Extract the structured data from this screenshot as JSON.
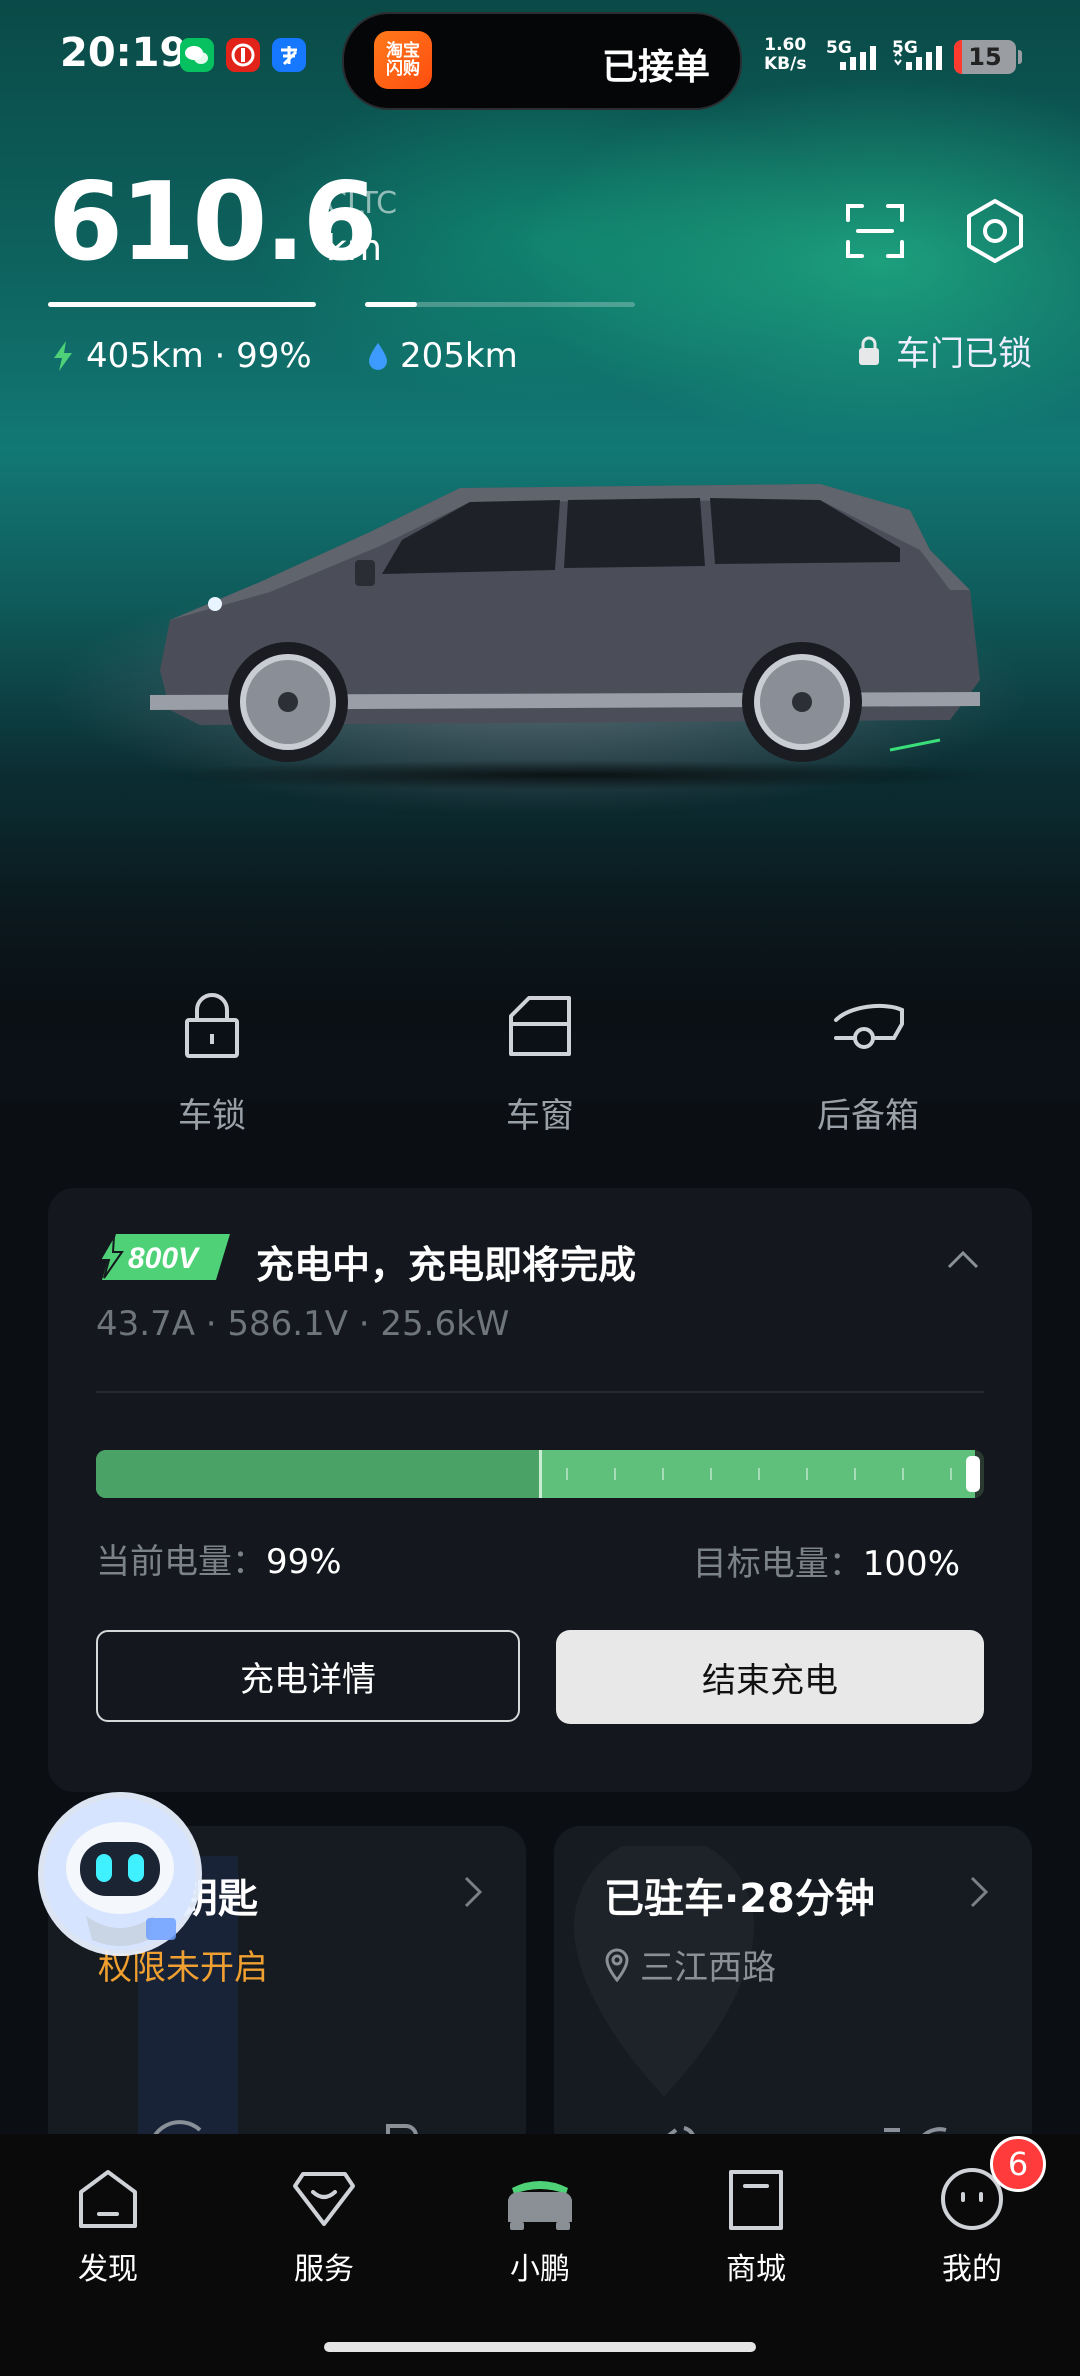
{
  "status_bar": {
    "time": "20:19",
    "island_app_label": "淘宝\n闪购",
    "island_text": "已接单",
    "net_speed_value": "1.60",
    "net_speed_unit": "KB/s",
    "sig1_label": "5G",
    "sig2_label": "5G",
    "battery": "15",
    "app_icons": [
      "wechat-icon",
      "union-pay-icon",
      "alipay-icon"
    ]
  },
  "range": {
    "value": "610.6",
    "standard": "CLTC",
    "unit": "km",
    "electric": "405km · 99%",
    "fuel": "205km",
    "lock_status": "车门已锁"
  },
  "controls": [
    {
      "label": "车锁",
      "icon": "padlock-icon"
    },
    {
      "label": "车窗",
      "icon": "window-icon"
    },
    {
      "label": "后备箱",
      "icon": "trunk-icon"
    }
  ],
  "charging": {
    "badge": "800V",
    "title": "充电中，充电即将完成",
    "stats": "43.7A · 586.1V · 25.6kW",
    "current_label": "当前电量：",
    "current_value": "99%",
    "target_label": "目标电量：",
    "target_value": "100%",
    "progress": 0.99,
    "detail_button": "充电详情",
    "stop_button": "结束充电"
  },
  "cards": {
    "key_title": "钥匙",
    "key_sub": "权限未开启",
    "parking_title": "已驻车·28分钟",
    "parking_location": "三江西路"
  },
  "nav": [
    {
      "label": "发现",
      "icon": "discover-icon"
    },
    {
      "label": "服务",
      "icon": "service-icon"
    },
    {
      "label": "小鹏",
      "icon": "car-icon"
    },
    {
      "label": "商城",
      "icon": "mall-icon"
    },
    {
      "label": "我的",
      "icon": "profile-icon"
    }
  ],
  "nav_badge": "6",
  "colors": {
    "accent_green": "#5ec07b",
    "warning_orange": "#f0a030",
    "fuel_blue": "#3d9bff",
    "badge_red": "#ff3b3b"
  }
}
